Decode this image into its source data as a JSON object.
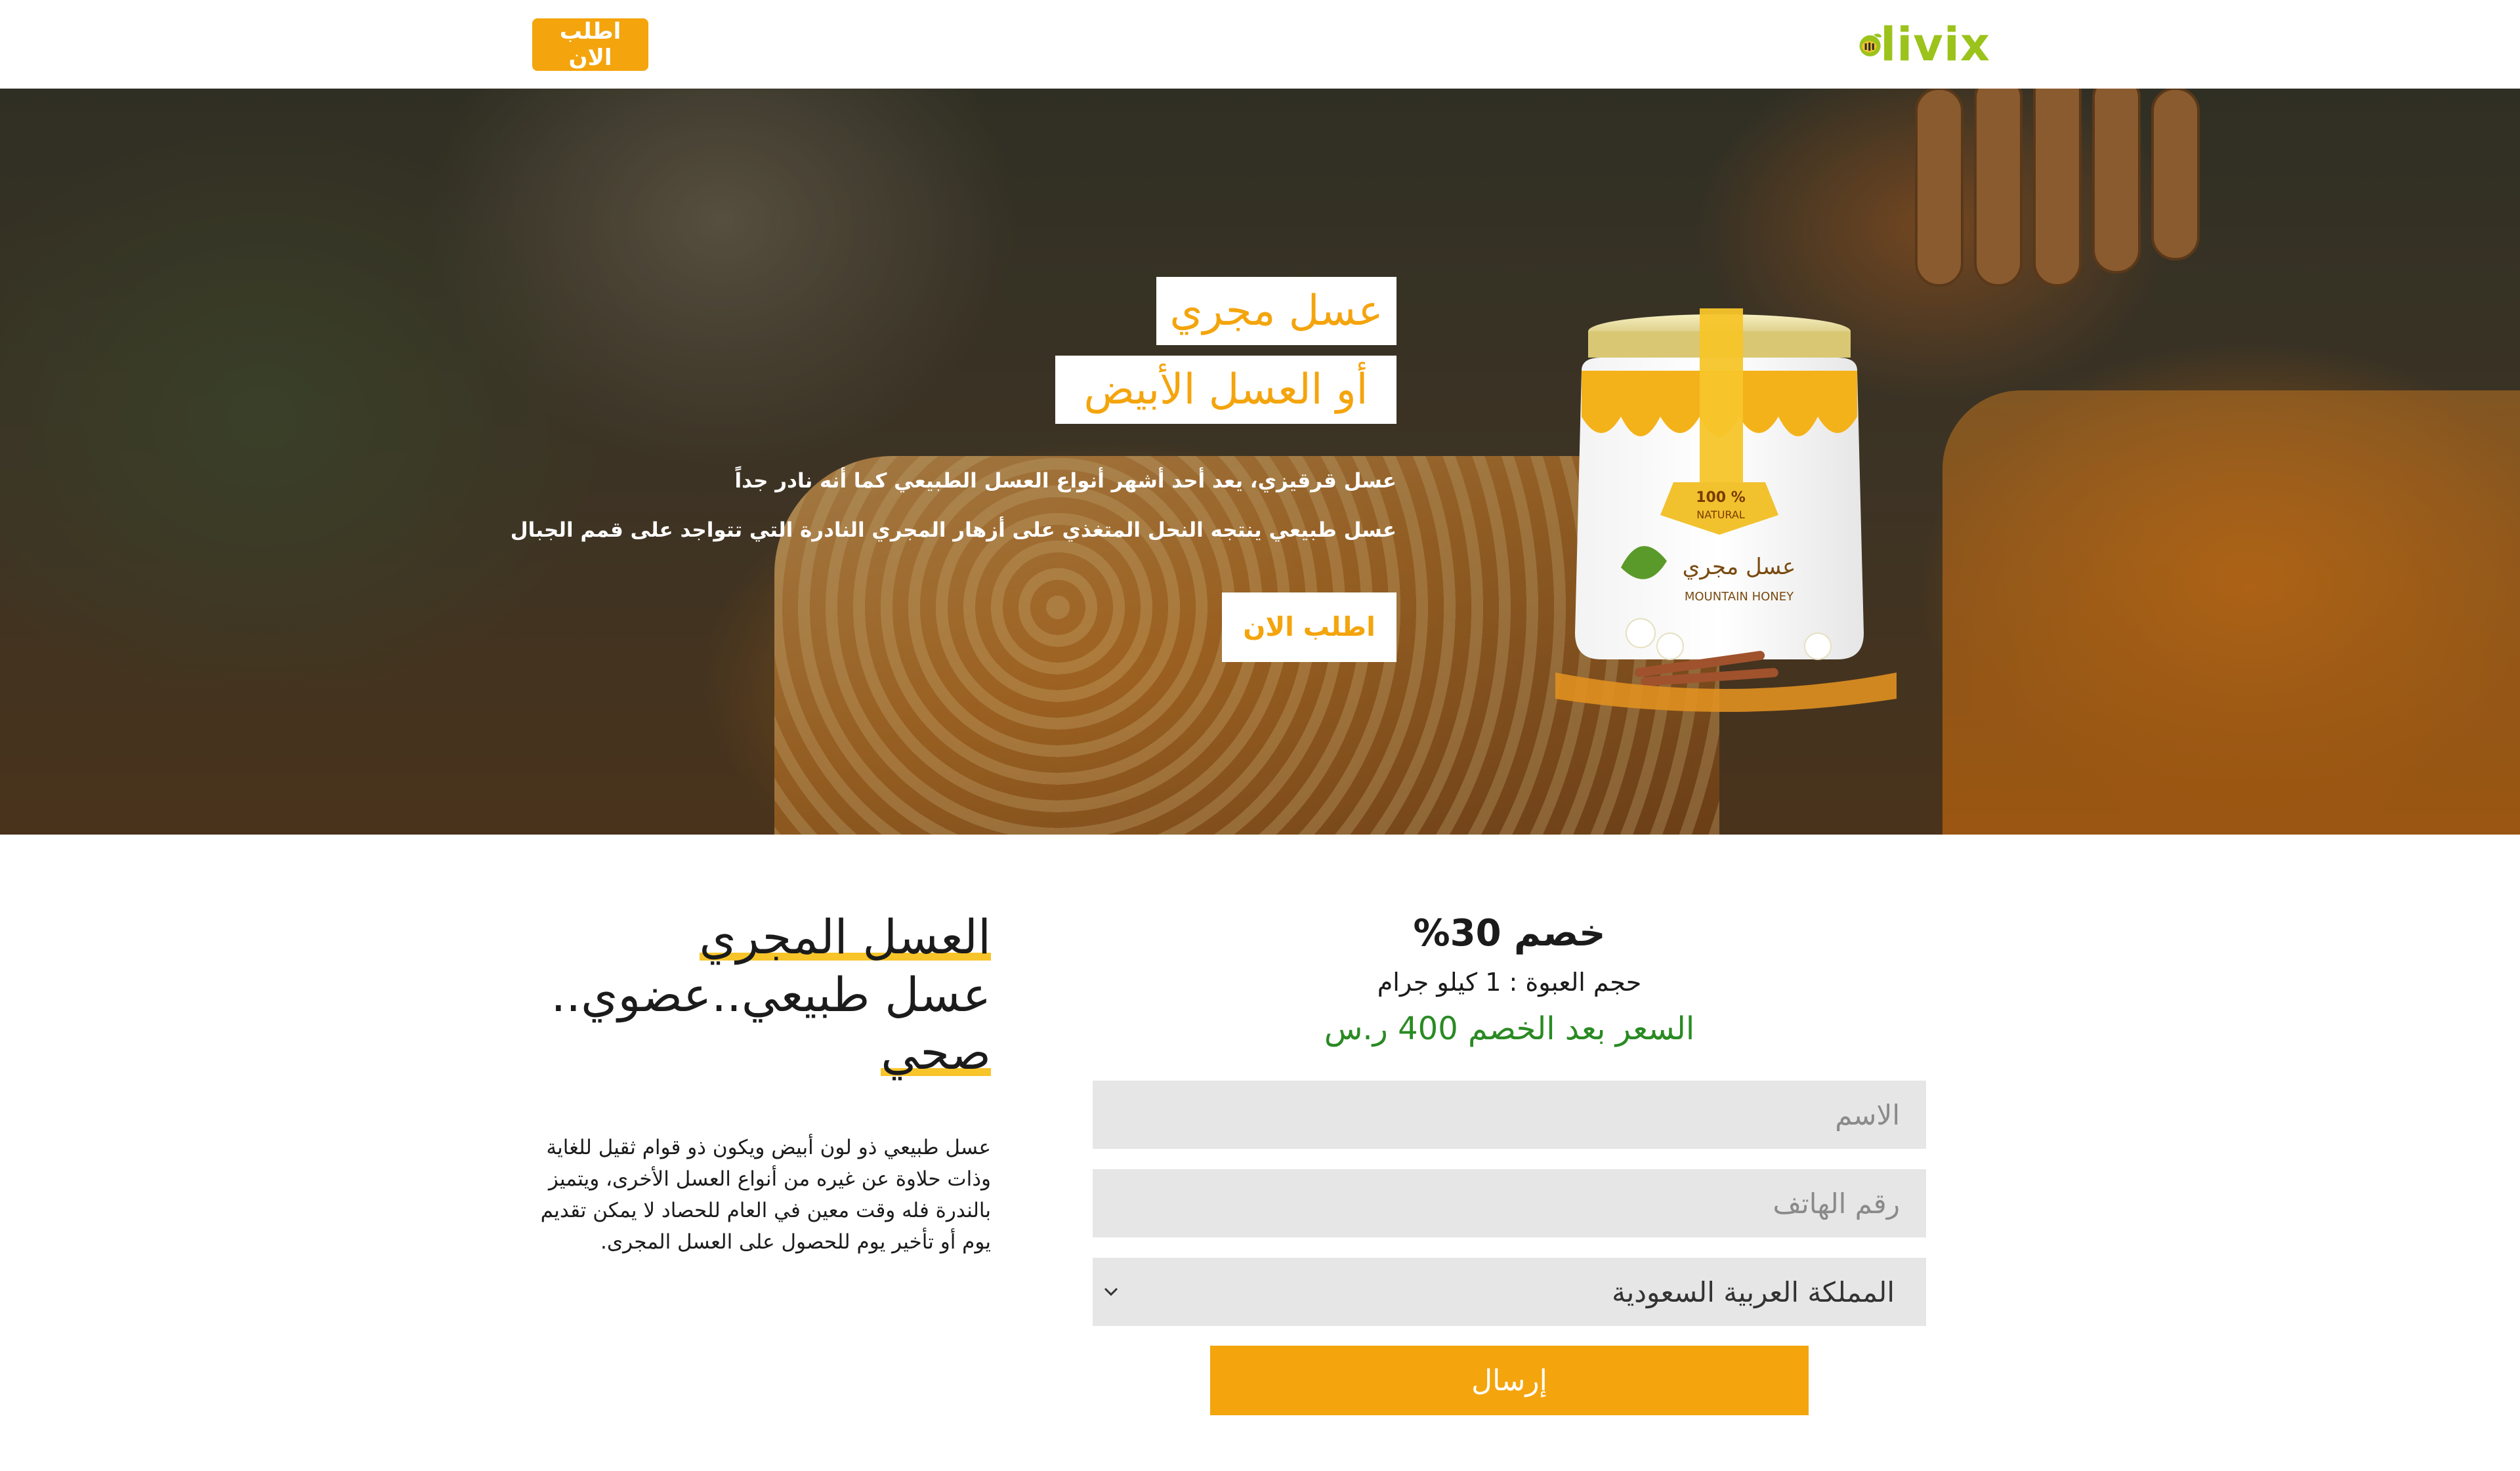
{
  "header": {
    "logo_text": "livix",
    "cta_label": "اطلب الان"
  },
  "hero": {
    "title_line1": "عسل مجري",
    "title_line2": "أو العسل الأبيض",
    "description_line1": "عسل قرقيزي، يعد أحد أشهر أنواع العسل الطبيعي كما أنه نادر جداً",
    "description_line2": "عسل طبيعي ينتجه النحل المتغذي على أزهار المجري النادرة التي تتواجد على قمم الجبال",
    "cta_label": "اطلب الان",
    "jar_label_top": "100 %",
    "jar_label_natural": "NATURAL",
    "jar_label_arabic": "عسل مجري",
    "jar_label_english": "MOUNTAIN HONEY"
  },
  "info": {
    "heading_line1": "العسل المجري",
    "heading_line2": "عسل طبيعي..عضوي..",
    "heading_line3": "صحي",
    "body": "عسل طبيعي ذو لون أبيض ويكون ذو قوام ثقيل للغاية وذات حلاوة عن غيره من أنواع العسل الأخرى، ويتميز بالندرة فله وقت معين في العام للحصاد لا يمكن تقديم يوم أو تأخير يوم للحصول على العسل المجرى."
  },
  "order_form": {
    "discount": "خصم 30%",
    "package_size": "حجم العبوة : 1 كيلو جرام",
    "price": "السعر بعد الخصم 400 ر.س",
    "name_placeholder": "الاسم",
    "phone_placeholder": "رقم الهاتف",
    "country_selected": "المملكة العربية السعودية",
    "submit_label": "إرسال"
  },
  "colors": {
    "accent": "#f4a40c",
    "price_green": "#2a8a23",
    "logo_green": "#9bc31c",
    "highlight_yellow": "#f7c52a",
    "field_bg": "#e6e6e6"
  },
  "icons": {
    "logo": "bee-logo-icon",
    "select": "chevron-down-icon"
  }
}
